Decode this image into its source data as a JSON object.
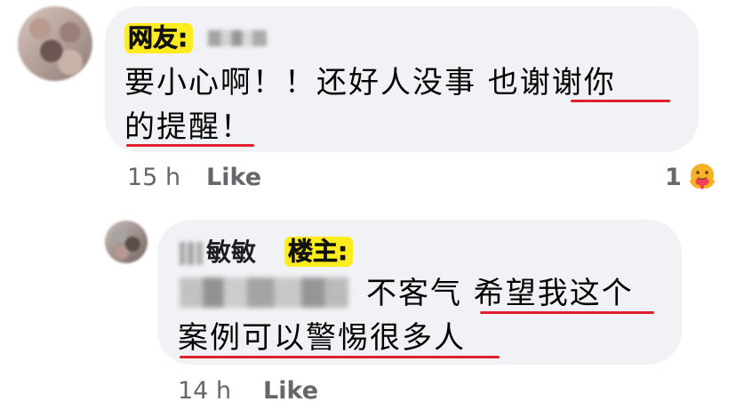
{
  "comments": [
    {
      "author_tag": "网友:",
      "text_line1": "要小心啊！！还好人没事 也谢谢你",
      "text_line2": "的提醒！",
      "time": "15 h",
      "like_label": "Like",
      "reaction_count": "1",
      "reaction_icon": "care-emoji-icon"
    },
    {
      "author_name": "敏敏",
      "author_tag": "楼主:",
      "text_line1": "不客气 希望我这个",
      "text_line2": "案例可以警惕很多人",
      "time": "14 h",
      "like_label": "Like"
    }
  ],
  "colors": {
    "bubble": "#f0f2f5",
    "tag_highlight": "#ffec1f",
    "underline": "#e0202c",
    "meta_text": "#65676b"
  }
}
